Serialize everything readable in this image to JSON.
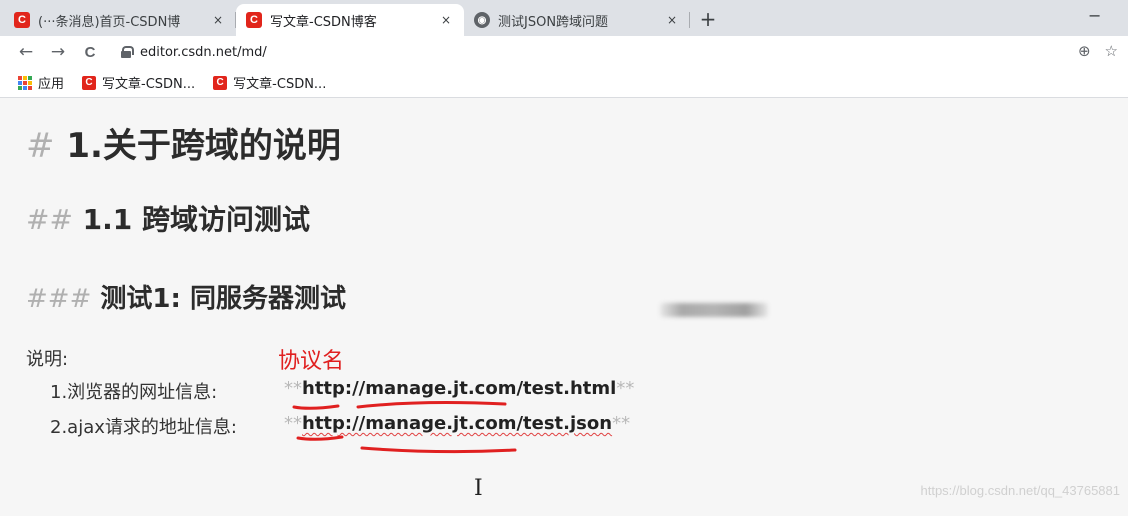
{
  "browser": {
    "tabs": [
      {
        "title": "(···条消息)首页-CSDN博",
        "favicon": "C",
        "active": false
      },
      {
        "title": "写文章-CSDN博客",
        "favicon": "C",
        "active": true
      },
      {
        "title": "测试JSON跨域问题",
        "favicon": "globe",
        "active": false
      }
    ],
    "new_tab_label": "+",
    "close_symbol": "×",
    "minimize_symbol": "−",
    "nav": {
      "back": "←",
      "forward": "→",
      "reload": "C"
    },
    "url": "editor.csdn.net/md/",
    "zoom_icon": "⊕",
    "star_icon": "☆"
  },
  "bookmarks": [
    {
      "label": "应用",
      "icon": "apps-grid-icon"
    },
    {
      "label": "写文章-CSDN...",
      "icon": "csdn-icon"
    },
    {
      "label": "写文章-CSDN...",
      "icon": "csdn-icon"
    }
  ],
  "editor": {
    "h1": {
      "mark": "#",
      "text": "1.关于跨域的说明"
    },
    "h2": {
      "mark": "##",
      "text": "1.1 跨域访问测试"
    },
    "h3": {
      "mark": "###",
      "text": "测试1: 同服务器测试"
    },
    "description_label": "说明:",
    "annotation": "协议名",
    "items": [
      {
        "label": "1.浏览器的网址信息:",
        "url": "http://manage.jt.com/test.html"
      },
      {
        "label": "2.ajax请求的地址信息:",
        "url": "http://manage.jt.com/test.json"
      }
    ],
    "bold_marker": "**"
  },
  "watermark": "https://blog.csdn.net/qq_43765881",
  "colors": {
    "csdn_red": "#e1251b",
    "annotation_red": "#e02020"
  }
}
